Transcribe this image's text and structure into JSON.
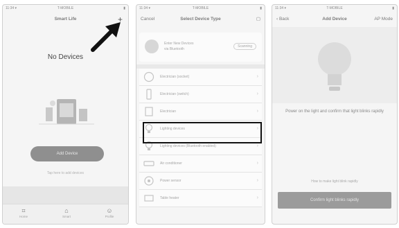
{
  "screen1": {
    "status": {
      "left": "11:34 ▾",
      "center": "T-MOBILE",
      "right": "▮"
    },
    "title": "Smart Life",
    "add_icon": "plus-icon",
    "empty_text": "No Devices",
    "add_button": "Add Device",
    "add_sub": "Tap here to add devices",
    "tabs": [
      {
        "label": "Home",
        "icon": "home-icon"
      },
      {
        "label": "Smart",
        "icon": "smart-icon"
      },
      {
        "label": "Profile",
        "icon": "profile-icon"
      }
    ]
  },
  "screen2": {
    "status": {
      "left": "11:34 ▾",
      "center": "T-MOBILE",
      "right": "▮"
    },
    "nav_left": "Cancel",
    "title": "Select Device Type",
    "scan_card": {
      "line1": "Enter New Devices",
      "line2": "via Bluetooth",
      "button": "Scanning"
    },
    "items": [
      {
        "label": "Electrician (socket)",
        "icon": "socket-icon"
      },
      {
        "label": "Electrician (switch)",
        "icon": "switch-icon"
      },
      {
        "label": "Electrician",
        "icon": "electrician-icon"
      },
      {
        "label": "Lighting devices",
        "icon": "bulb-icon"
      },
      {
        "label": "Lighting devices (Bluetooth enabled)",
        "icon": "bulb-bt-icon"
      },
      {
        "label": "Air conditioner",
        "icon": "ac-icon"
      },
      {
        "label": "Power sensor",
        "icon": "sensor-icon"
      },
      {
        "label": "Table heater",
        "icon": "heater-icon"
      }
    ]
  },
  "screen3": {
    "status": {
      "left": "11:34 ▾",
      "center": "T-MOBILE",
      "right": "▮"
    },
    "nav_left": "‹ Back",
    "title": "Add Device",
    "nav_right": "AP Mode",
    "instruction": "Power on the light and confirm that light blinks rapidly",
    "link": "How to make light blink rapidly",
    "confirm_button": "Confirm light blinks rapidly"
  }
}
